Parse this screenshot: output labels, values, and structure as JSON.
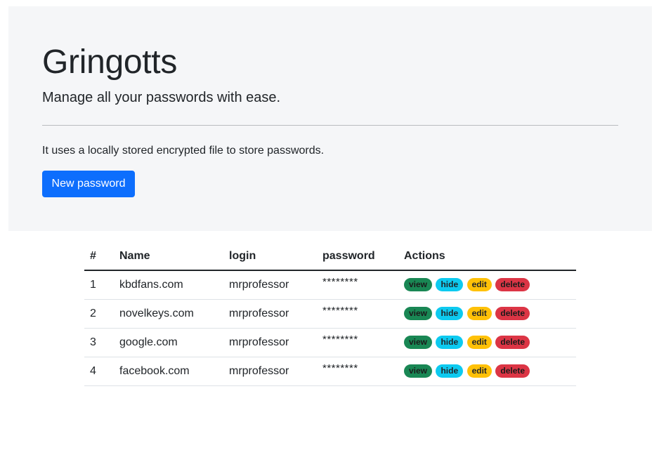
{
  "header": {
    "title": "Gringotts",
    "lead": "Manage all your passwords with ease.",
    "description": "It uses a locally stored encrypted file to store passwords.",
    "new_button_label": "New password"
  },
  "table": {
    "columns": [
      "#",
      "Name",
      "login",
      "password",
      "Actions"
    ],
    "action_labels": {
      "view": "view",
      "hide": "hide",
      "edit": "edit",
      "delete": "delete"
    },
    "rows": [
      {
        "num": "1",
        "name": "kbdfans.com",
        "login": "mrprofessor",
        "password": "********"
      },
      {
        "num": "2",
        "name": "novelkeys.com",
        "login": "mrprofessor",
        "password": "********"
      },
      {
        "num": "3",
        "name": "google.com",
        "login": "mrprofessor",
        "password": "********"
      },
      {
        "num": "4",
        "name": "facebook.com",
        "login": "mrprofessor",
        "password": "********"
      }
    ]
  },
  "colors": {
    "primary": "#0d6efd",
    "view": "#198754",
    "hide": "#0dcaf0",
    "edit": "#ffc107",
    "delete": "#dc3545",
    "jumbotron_bg": "#f5f6f8"
  }
}
